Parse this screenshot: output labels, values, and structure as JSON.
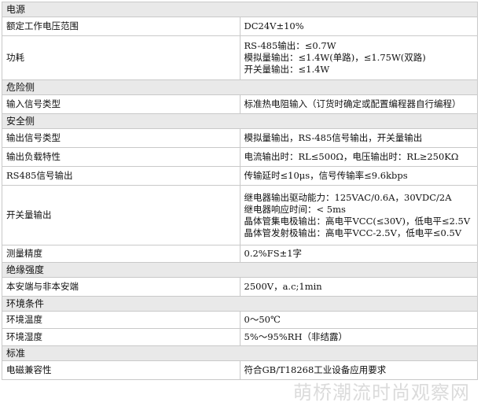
{
  "sections": {
    "power": "电源",
    "danger": "危险侧",
    "safe": "安全侧",
    "insulation": "绝缘强度",
    "environment": "环境条件",
    "standard": "标准"
  },
  "rows": {
    "rated_range": {
      "label": "额定工作电压范围",
      "value": "DC24V±10%"
    },
    "power_consumption": {
      "label": "功耗",
      "lines": [
        "RS-485输出：≤0.7W",
        "模拟量输出：≤1.4W(单路)，≤1.75W(双路)",
        "开关量输出：≤1.4W"
      ]
    },
    "input_type": {
      "label": "输入信号类型",
      "value": "标准热电阻输入（订货时确定或配置编程器自行编程）"
    },
    "output_type": {
      "label": "输出信号类型",
      "value": "模拟量输出，RS-485信号输出，开关量输出"
    },
    "output_load": {
      "label": "输出负载特性",
      "value": "电流输出时：RL≤500Ω，电压输出时：RL≥250KΩ"
    },
    "rs485": {
      "label": "RS485信号输出",
      "value": "传输延时≤10μs，信号传输率≤9.6kbps"
    },
    "switch_output": {
      "label": "开关量输出",
      "lines": [
        "继电器输出驱动能力：125VAC/0.6A，30VDC/2A",
        "继电器响应时间：< 5ms",
        "晶体管集电极输出：高电平VCC(≤30V)，低电平≤2.5V",
        "晶体管发射极输出：高电平VCC-2.5V，低电平≤0.5V"
      ]
    },
    "accuracy": {
      "label": "测量精度",
      "value": "0.2%FS±1字"
    },
    "isolation": {
      "label": "本安端与非本安端",
      "value": "2500V，a.c;1min"
    },
    "env_temp": {
      "label": "环境温度",
      "value": "0～50℃"
    },
    "env_humidity": {
      "label": "环境湿度",
      "value": "5%～95%RH（非结露）"
    },
    "emc": {
      "label": "电磁兼容性",
      "value": "符合GB/T18268工业设备应用要求"
    }
  },
  "watermark": "萌桥潮流时尚观察网"
}
